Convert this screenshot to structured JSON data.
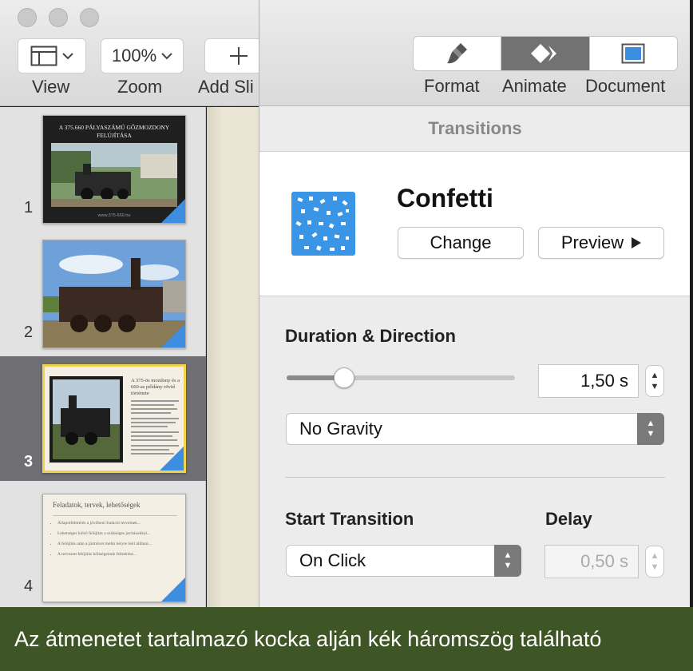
{
  "toolbar": {
    "view_label": "View",
    "zoom_value": "100%",
    "zoom_label": "Zoom",
    "add_slide_label": "Add Sli"
  },
  "slides": [
    {
      "number": "1",
      "title": "A 375.660 PÁLYASZÁMÚ GŐZMOZDONY FELÚJÍTÁSA",
      "footer": "www.375-660.hu"
    },
    {
      "number": "2"
    },
    {
      "number": "3",
      "heading": "A 375-ös mozdony és a 660-as példány rövid története"
    },
    {
      "number": "4",
      "heading": "Feladatok, tervek, lehetőségek",
      "bullets": [
        "Állapotfelmérés a jövőbeni funkció terveinek...",
        "Lehetséges külső felújítás a szükséges javításokkal...",
        "A felújítás után a járművet méltó helyre kell állítani...",
        "A tervezett felújítás költségeinek felmérése..."
      ]
    }
  ],
  "inspector": {
    "tabs": [
      {
        "label": "Format",
        "icon": "paintbrush-icon"
      },
      {
        "label": "Animate",
        "icon": "animate-diamond-icon"
      },
      {
        "label": "Document",
        "icon": "document-icon"
      }
    ],
    "section_title": "Transitions",
    "effect_name": "Confetti",
    "change_label": "Change",
    "preview_label": "Preview",
    "duration_heading": "Duration & Direction",
    "duration_value": "1,50 s",
    "duration_level": 0.25,
    "direction_value": "No Gravity",
    "start_heading": "Start Transition",
    "delay_heading": "Delay",
    "start_value": "On Click",
    "delay_value": "0,50 s"
  },
  "caption": "Az átmenetet tartalmazó kocka alján kék háromszög található",
  "colors": {
    "accent": "#3d8ee0",
    "selection": "#f2d44c",
    "caption_bg": "#3e5625"
  }
}
